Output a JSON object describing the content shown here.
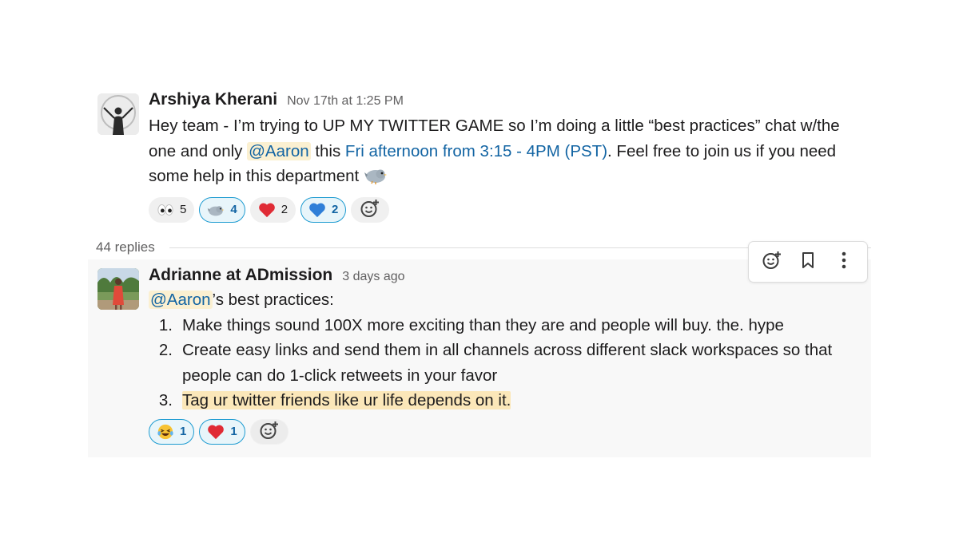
{
  "colors": {
    "mention_bg": "#fbf0d1",
    "link": "#1264a3",
    "active_reaction_border": "#1d9bd1",
    "reply_bg": "#f8f8f8"
  },
  "parent_message": {
    "sender": "Arshiya Kherani",
    "timestamp": "Nov 17th at 1:25 PM",
    "text_1": "Hey team - I’m trying to UP MY TWITTER GAME so I’m doing a little “best practices” chat w/the one and only ",
    "mention": "@Aaron",
    "text_2": " this ",
    "event_link": "Fri afternoon from 3:15 - 4PM (PST)",
    "text_3": ". Feel free to join us if you need some help in this department ",
    "reactions": [
      {
        "emoji": "eyes-emoji",
        "count": "5",
        "active": false
      },
      {
        "emoji": "bird-emoji",
        "count": "4",
        "active": true
      },
      {
        "emoji": "red-heart-emoji",
        "count": "2",
        "active": false
      },
      {
        "emoji": "blue-heart-emoji",
        "count": "2",
        "active": true
      }
    ]
  },
  "thread": {
    "replies_label": "44 replies"
  },
  "reply_message": {
    "sender": "Adrianne at ADmission",
    "timestamp": "3 days ago",
    "mention": "@Aaron",
    "intro_suffix": "’s best practices:",
    "list": [
      {
        "num": "1.",
        "text": "Make things sound 100X more exciting than they are and people will buy. the. hype"
      },
      {
        "num": "2.",
        "text": "Create easy links and send them in all channels across different slack workspaces so that people can do 1-click retweets in your favor"
      },
      {
        "num": "3.",
        "text": "Tag ur twitter friends like ur life depends on it."
      }
    ],
    "reactions": [
      {
        "emoji": "laughing-tears-emoji",
        "count": "1",
        "active": true
      },
      {
        "emoji": "red-heart-emoji",
        "count": "1",
        "active": true
      }
    ]
  },
  "hover_toolbar": {
    "icons": [
      "add-reaction-icon",
      "bookmark-icon",
      "more-actions-icon"
    ]
  }
}
